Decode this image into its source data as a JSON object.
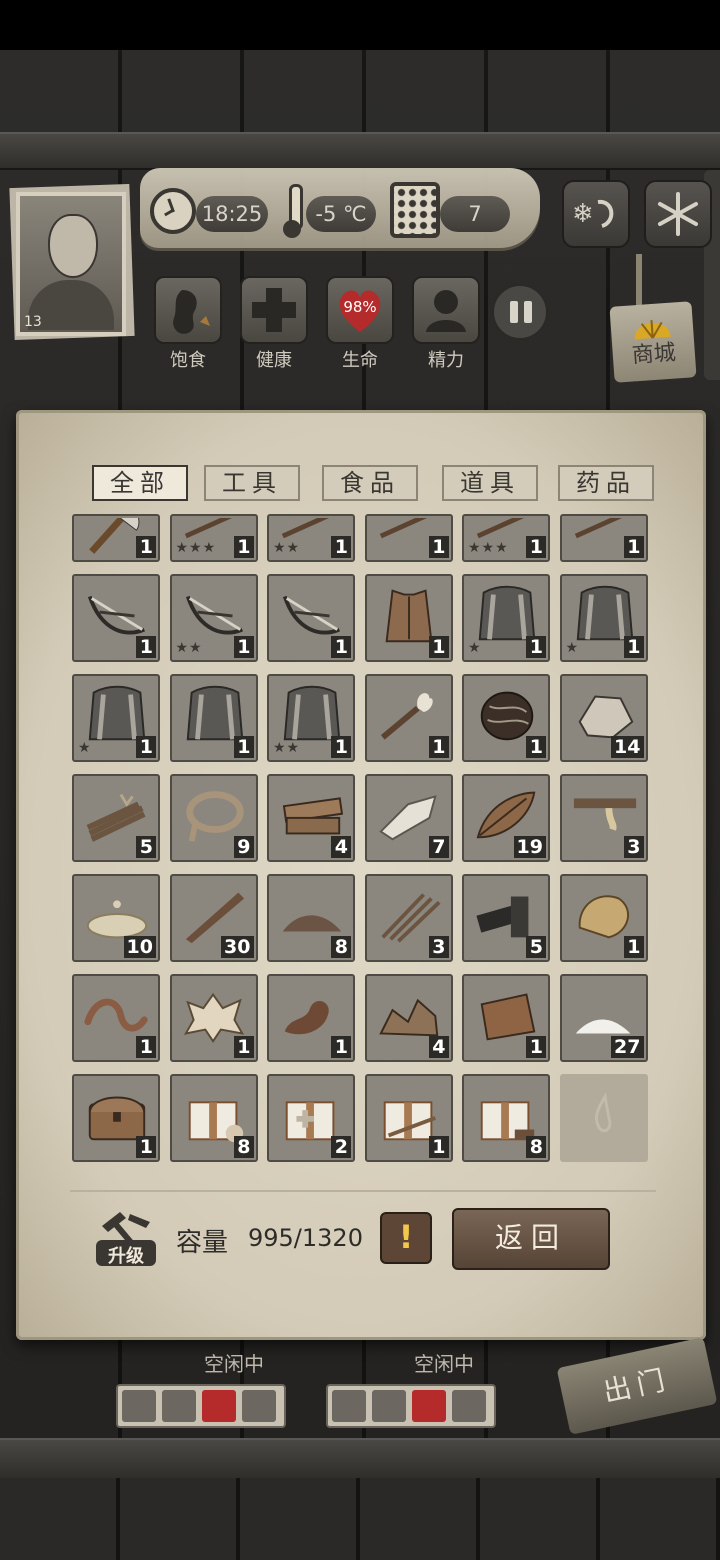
{
  "hud": {
    "time": "18:25",
    "temperature": "-5 ℃",
    "day": "7",
    "level": "13",
    "health_percent": "98%"
  },
  "stats": [
    {
      "name": "satiety",
      "label": "饱食",
      "icon": "stomach-icon"
    },
    {
      "name": "health",
      "label": "健康",
      "icon": "cross-icon"
    },
    {
      "name": "life",
      "label": "生命",
      "icon": "heart-icon"
    },
    {
      "name": "energy",
      "label": "精力",
      "icon": "person-icon"
    }
  ],
  "shop_label": "商城",
  "tabs": [
    {
      "label": "全部",
      "active": true
    },
    {
      "label": "工具",
      "active": false
    },
    {
      "label": "食品",
      "active": false
    },
    {
      "label": "道具",
      "active": false
    },
    {
      "label": "药品",
      "active": false
    }
  ],
  "items": [
    {
      "icon": "axe-icon",
      "qty": "1",
      "stars": ""
    },
    {
      "icon": "spear-icon",
      "qty": "1",
      "stars": "★★★"
    },
    {
      "icon": "spear-icon",
      "qty": "1",
      "stars": "★★"
    },
    {
      "icon": "spear-icon",
      "qty": "1",
      "stars": ""
    },
    {
      "icon": "spear-icon",
      "qty": "1",
      "stars": "★★★"
    },
    {
      "icon": "spear-icon",
      "qty": "1",
      "stars": ""
    },
    {
      "icon": "crossbow-icon",
      "qty": "1",
      "stars": ""
    },
    {
      "icon": "crossbow-icon",
      "qty": "1",
      "stars": "★★"
    },
    {
      "icon": "crossbow-icon",
      "qty": "1",
      "stars": ""
    },
    {
      "icon": "leather-vest-icon",
      "qty": "1",
      "stars": ""
    },
    {
      "icon": "cloak-icon",
      "qty": "1",
      "stars": "★"
    },
    {
      "icon": "cloak-icon",
      "qty": "1",
      "stars": "★"
    },
    {
      "icon": "cloak-icon",
      "qty": "1",
      "stars": "★"
    },
    {
      "icon": "cloak-icon",
      "qty": "1",
      "stars": ""
    },
    {
      "icon": "cloak-icon",
      "qty": "1",
      "stars": "★★"
    },
    {
      "icon": "torch-icon",
      "qty": "1",
      "stars": ""
    },
    {
      "icon": "nut-icon",
      "qty": "1",
      "stars": ""
    },
    {
      "icon": "stone-icon",
      "qty": "14",
      "stars": ""
    },
    {
      "icon": "branch-bundle-icon",
      "qty": "5",
      "stars": ""
    },
    {
      "icon": "rope-icon",
      "qty": "9",
      "stars": ""
    },
    {
      "icon": "wood-plank-icon",
      "qty": "4",
      "stars": ""
    },
    {
      "icon": "flint-icon",
      "qty": "7",
      "stars": ""
    },
    {
      "icon": "leaf-icon",
      "qty": "19",
      "stars": ""
    },
    {
      "icon": "resin-branch-icon",
      "qty": "3",
      "stars": ""
    },
    {
      "icon": "glue-puddle-icon",
      "qty": "10",
      "stars": ""
    },
    {
      "icon": "stake-icon",
      "qty": "30",
      "stars": ""
    },
    {
      "icon": "dirt-pile-icon",
      "qty": "8",
      "stars": ""
    },
    {
      "icon": "arrows-icon",
      "qty": "3",
      "stars": ""
    },
    {
      "icon": "charcoal-icon",
      "qty": "5",
      "stars": ""
    },
    {
      "icon": "ore-icon",
      "qty": "1",
      "stars": ""
    },
    {
      "icon": "worm-icon",
      "qty": "1",
      "stars": ""
    },
    {
      "icon": "animal-hide-icon",
      "qty": "1",
      "stars": ""
    },
    {
      "icon": "mud-icon",
      "qty": "1",
      "stars": ""
    },
    {
      "icon": "rock-pile-icon",
      "qty": "4",
      "stars": ""
    },
    {
      "icon": "cloth-icon",
      "qty": "1",
      "stars": ""
    },
    {
      "icon": "salt-icon",
      "qty": "27",
      "stars": ""
    },
    {
      "icon": "chest-icon",
      "qty": "1",
      "stars": ""
    },
    {
      "icon": "food-gift-box-icon",
      "qty": "8",
      "stars": ""
    },
    {
      "icon": "medical-gift-box-icon",
      "qty": "2",
      "stars": ""
    },
    {
      "icon": "weapon-gift-box-icon",
      "qty": "1",
      "stars": ""
    },
    {
      "icon": "wood-gift-box-icon",
      "qty": "8",
      "stars": ""
    },
    {
      "icon": "empty-slot-icon",
      "qty": "",
      "stars": ""
    }
  ],
  "footer": {
    "upgrade_label": "升级",
    "capacity_label": "容量",
    "capacity_value": "995/1320",
    "warn": "!",
    "back_label": "返回"
  },
  "survivors": [
    {
      "status": "空闲中"
    },
    {
      "status": "空闲中"
    }
  ],
  "exit_label": "出门",
  "colors": {
    "parchment": "#d3cbb7",
    "slot": "#8b877e",
    "qty_bg": "#2c2a27",
    "heart": "#b52a2a",
    "warn": "#f2c94c"
  }
}
